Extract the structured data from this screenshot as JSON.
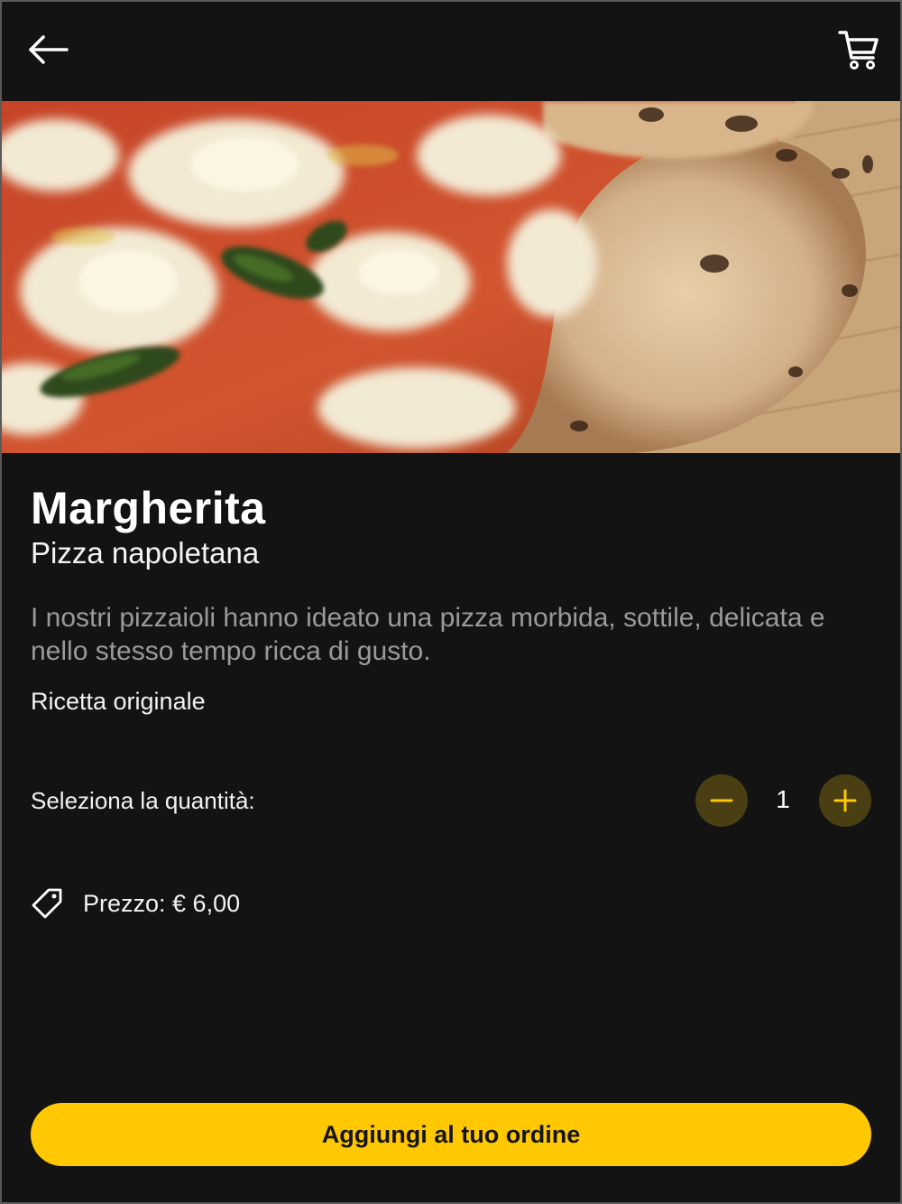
{
  "header": {
    "back_icon": "arrow-left-icon",
    "cart_icon": "shopping-cart-icon"
  },
  "hero": {
    "image": "margherita-pizza-photo"
  },
  "product": {
    "name": "Margherita",
    "category": "Pizza napoletana",
    "description": "I nostri pizzaioli hanno ideato una pizza morbida, sottile, delicata e nello stesso tempo ricca di gusto.",
    "note": "Ricetta originale"
  },
  "quantity": {
    "label": "Seleziona la quantità:",
    "value": "1",
    "decrement_icon": "minus-icon",
    "increment_icon": "plus-icon"
  },
  "price": {
    "icon": "price-tag-icon",
    "text": "Prezzo: € 6,00"
  },
  "cta": {
    "label": "Aggiungi al tuo ordine"
  },
  "colors": {
    "background": "#131313",
    "accent": "#ffc800",
    "stepper_bg": "#4a3f13",
    "muted_text": "#9a9a9a"
  }
}
